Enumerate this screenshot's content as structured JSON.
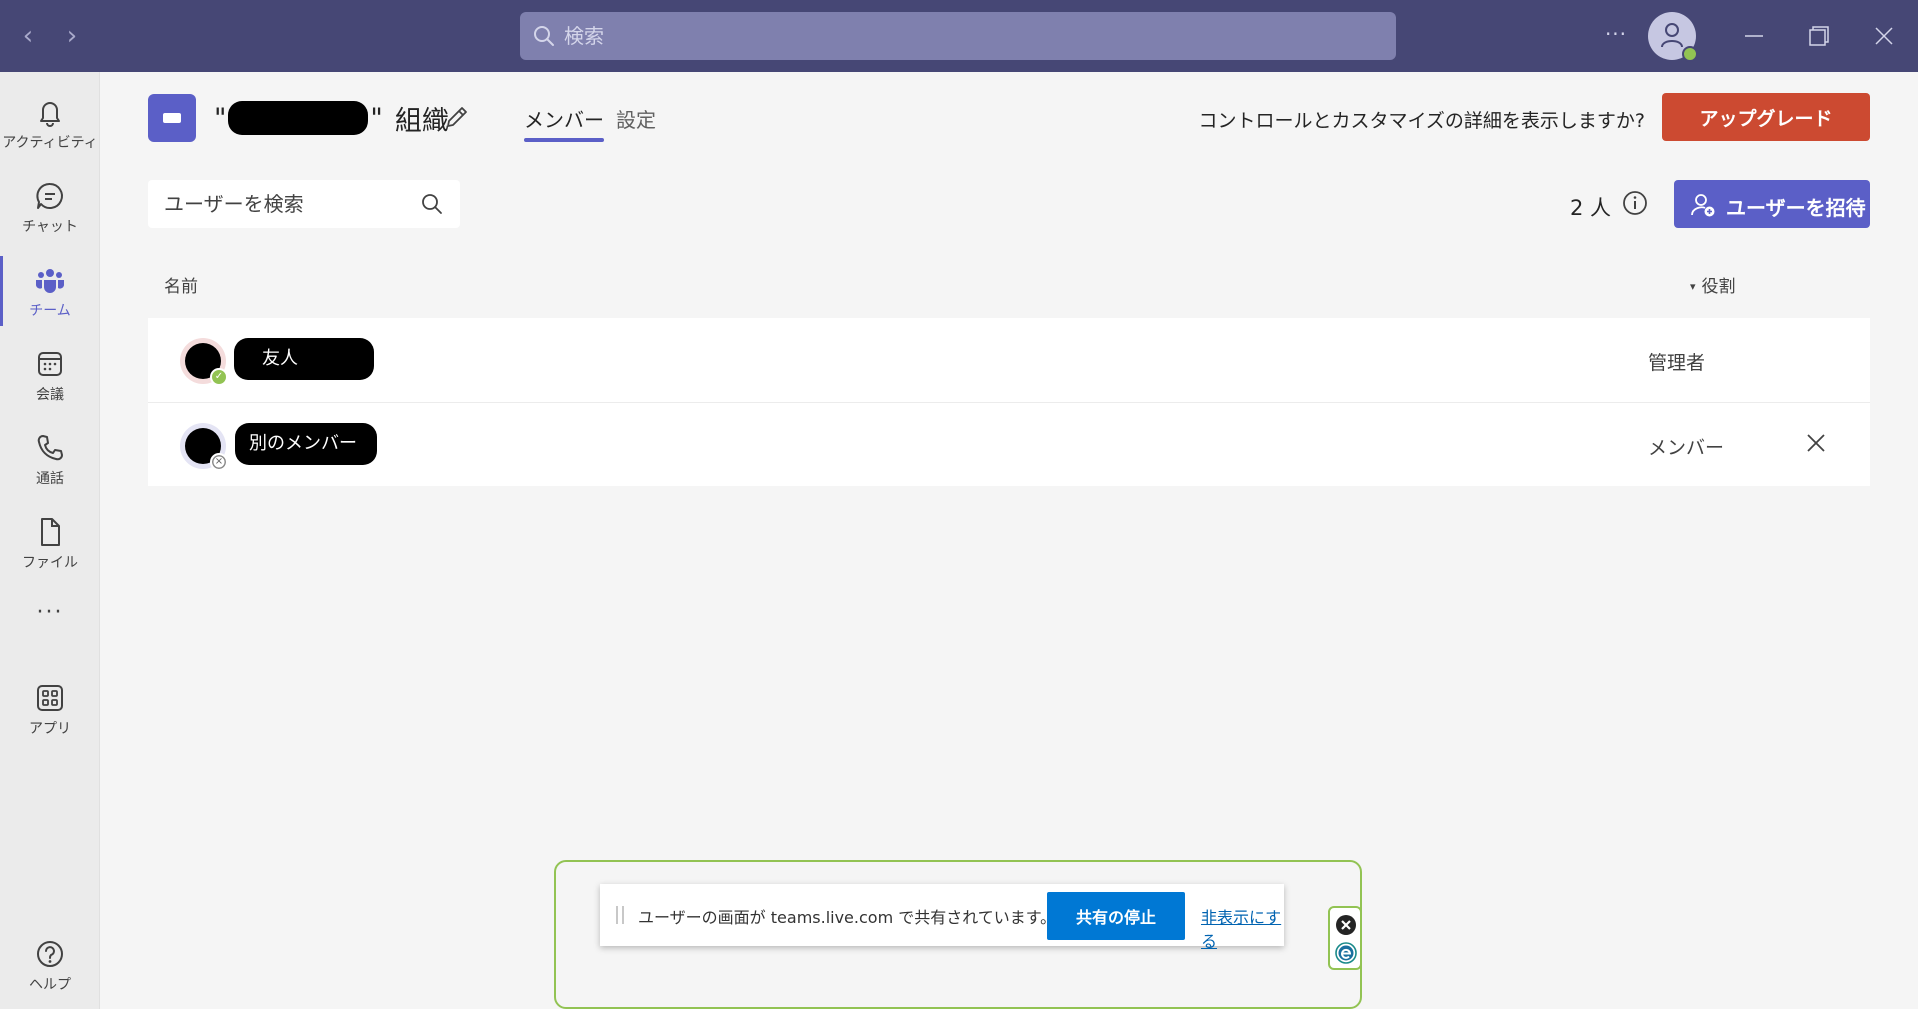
{
  "titlebar": {
    "search_placeholder": "検索",
    "more": "···"
  },
  "rail": {
    "items": [
      {
        "label": "アクティビティ"
      },
      {
        "label": "チャット"
      },
      {
        "label": "チーム"
      },
      {
        "label": "会議"
      },
      {
        "label": "通話"
      },
      {
        "label": "ファイル"
      },
      {
        "label": "アプリ"
      },
      {
        "label": "ヘルプ"
      }
    ],
    "more": "···"
  },
  "header": {
    "org_quote_open": "\"",
    "org_quote_close": "\"",
    "org_suffix": "組織",
    "tabs": [
      {
        "label": "メンバー"
      },
      {
        "label": "設定"
      }
    ],
    "upgrade_question": "コントロールとカスタマイズの詳細を表示しますか?",
    "upgrade_label": "アップグレード"
  },
  "toolbar": {
    "search_placeholder": "ユーザーを検索",
    "count": "2 人",
    "invite_label": "ユーザーを招待"
  },
  "table": {
    "col_name": "名前",
    "col_role": "役割",
    "sort_caret": "▾",
    "rows": [
      {
        "name": "友人",
        "role": "管理者",
        "presence": "available"
      },
      {
        "name": "別のメンバー",
        "role": "メンバー",
        "presence": "offline"
      }
    ]
  },
  "share_bar": {
    "message": "ユーザーの画面が teams.live.com で共有されています。",
    "stop_label": "共有の停止",
    "hide_label": "非表示にする"
  },
  "colors": {
    "titlebar": "#464775",
    "accent": "#5b5fc7",
    "upgrade": "#cc4a31",
    "share_stop": "#0078d4",
    "presence_available": "#92c353"
  }
}
